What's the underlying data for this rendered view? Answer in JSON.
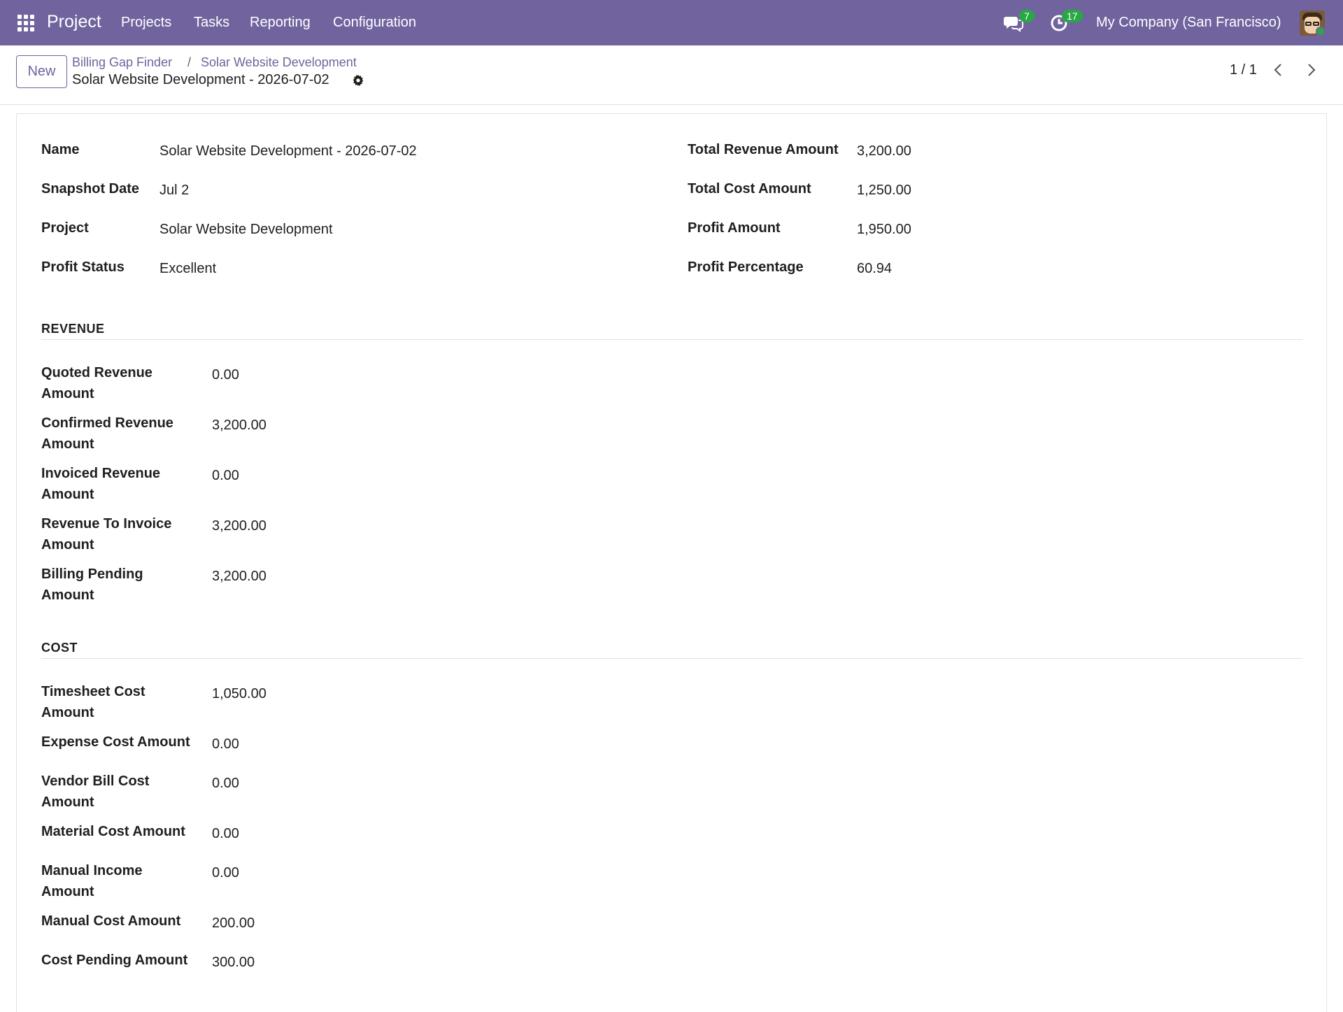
{
  "navbar": {
    "app_name": "Project",
    "menu": [
      "Projects",
      "Tasks",
      "Reporting",
      "Configuration"
    ],
    "messages_badge": "7",
    "activities_badge": "17",
    "company": "My Company (San Francisco)",
    "color": "#71639e"
  },
  "control": {
    "new_label": "New",
    "breadcrumb": [
      "Billing Gap Finder",
      "Solar Website Development"
    ],
    "breadcrumb_sep": "/",
    "record_title": "Solar Website Development - 2026-07-02",
    "pager": "1 / 1"
  },
  "summary": {
    "left": [
      {
        "label": "Name",
        "value": "Solar Website Development - 2026-07-02"
      },
      {
        "label": "Snapshot Date",
        "value": "Jul 2"
      },
      {
        "label": "Project",
        "value": "Solar Website Development"
      },
      {
        "label": "Profit Status",
        "value": "Excellent"
      }
    ],
    "right": [
      {
        "label": "Total Revenue Amount",
        "value": "3,200.00"
      },
      {
        "label": "Total Cost Amount",
        "value": "1,250.00"
      },
      {
        "label": "Profit Amount",
        "value": "1,950.00"
      },
      {
        "label": "Profit Percentage",
        "value": "60.94"
      }
    ]
  },
  "revenue": {
    "title": "REVENUE",
    "fields": [
      {
        "label_l1": "Quoted Revenue",
        "label_l2": "Amount",
        "value": "0.00"
      },
      {
        "label_l1": "Confirmed Revenue",
        "label_l2": "Amount",
        "value": "3,200.00"
      },
      {
        "label_l1": "Invoiced Revenue",
        "label_l2": "Amount",
        "value": "0.00"
      },
      {
        "label_l1": "Revenue To Invoice",
        "label_l2": "Amount",
        "value": "3,200.00"
      },
      {
        "label_l1": "Billing Pending",
        "label_l2": "Amount",
        "value": "3,200.00"
      }
    ]
  },
  "cost": {
    "title": "COST",
    "fields": [
      {
        "label_l1": "Timesheet Cost",
        "label_l2": "Amount",
        "value": "1,050.00"
      },
      {
        "label_l1": "Expense Cost Amount",
        "label_l2": "",
        "value": "0.00"
      },
      {
        "label_l1": "Vendor Bill Cost",
        "label_l2": "Amount",
        "value": "0.00"
      },
      {
        "label_l1": "Material Cost Amount",
        "label_l2": "",
        "value": "0.00"
      },
      {
        "label_l1": "Manual Income",
        "label_l2": "Amount",
        "value": "0.00"
      },
      {
        "label_l1": "Manual Cost Amount",
        "label_l2": "",
        "value": "200.00"
      },
      {
        "label_l1": "Cost Pending Amount",
        "label_l2": "",
        "value": "300.00"
      }
    ]
  }
}
